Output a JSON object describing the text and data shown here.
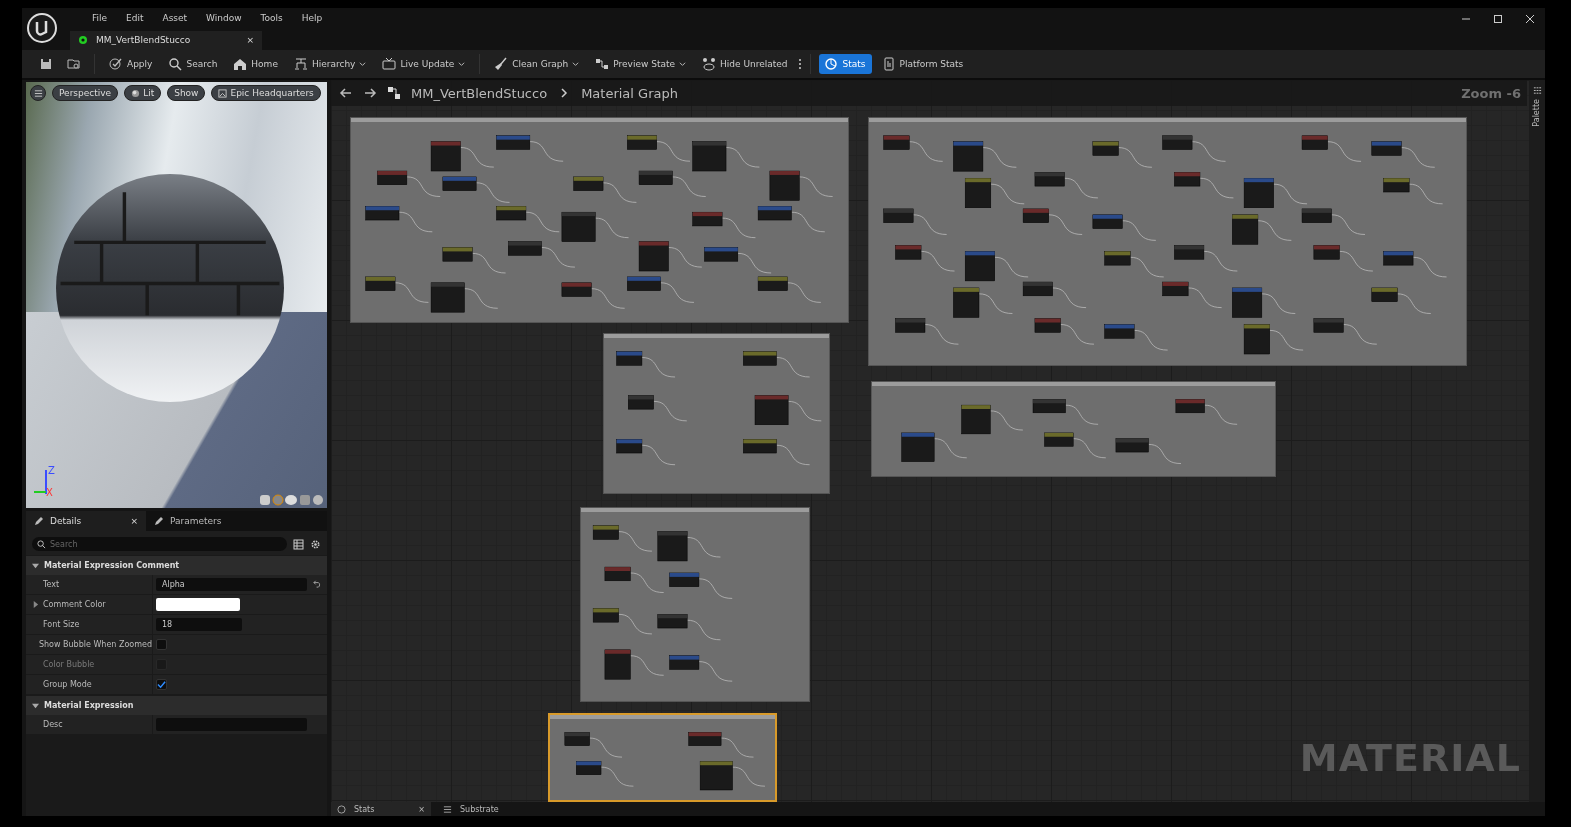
{
  "menu": [
    "File",
    "Edit",
    "Asset",
    "Window",
    "Tools",
    "Help"
  ],
  "document_tab": {
    "title": "MM_VertBlendStucco",
    "close": "×"
  },
  "toolbar": [
    {
      "kind": "icon",
      "on": false
    },
    {
      "kind": "icon",
      "on": false
    },
    {
      "label": "Apply",
      "kind": "button",
      "on": false
    },
    {
      "label": "Search",
      "kind": "button",
      "on": false
    },
    {
      "label": "Home",
      "kind": "button",
      "on": false
    },
    {
      "label": "Hierarchy",
      "kind": "dropdown",
      "on": false
    },
    {
      "label": "Live Update",
      "kind": "dropdown",
      "on": false
    },
    {
      "label": "Clean Graph",
      "kind": "dropdown",
      "on": false
    },
    {
      "label": "Preview State",
      "kind": "dropdown",
      "on": false
    },
    {
      "label": "Hide Unrelated",
      "kind": "button",
      "on": false
    },
    {
      "label": "Stats",
      "kind": "button",
      "on": true
    },
    {
      "label": "Platform Stats",
      "kind": "button",
      "on": false
    }
  ],
  "viewport": {
    "buttons": [
      "Perspective",
      "Lit",
      "Show",
      "Epic Headquarters"
    ],
    "axis_z": "Z",
    "axis_x": "X"
  },
  "details": {
    "tabs": [
      {
        "label": "Details",
        "selected": true,
        "close": "×"
      },
      {
        "label": "Parameters",
        "selected": false
      }
    ],
    "search": {
      "placeholder": "Search"
    },
    "sections": [
      {
        "title": "Material Expression Comment",
        "expanded": true,
        "rows": [
          {
            "label": "Text",
            "kind": "text",
            "value": "Alpha",
            "resettable": true
          },
          {
            "label": "Comment Color",
            "kind": "color",
            "color": "#ffffff",
            "expanded": false
          },
          {
            "label": "Font Size",
            "kind": "number",
            "value": "18"
          },
          {
            "label": "Show Bubble When Zoomed",
            "kind": "checkbox",
            "checked": false,
            "disabled": false
          },
          {
            "label": "Color Bubble",
            "kind": "checkbox",
            "checked": false,
            "disabled": true
          },
          {
            "label": "Group Mode",
            "kind": "checkbox",
            "checked": true,
            "disabled": false
          }
        ]
      },
      {
        "title": "Material Expression",
        "expanded": true,
        "rows": [
          {
            "label": "Desc",
            "kind": "text",
            "value": "",
            "resettable": false
          }
        ]
      }
    ]
  },
  "graph": {
    "breadcrumb": [
      "MM_VertBlendStucco",
      "Material Graph"
    ],
    "zoom": "Zoom -6",
    "watermark": "MATERIAL",
    "palette": "Palette",
    "comments": [
      {
        "selected": false
      },
      {
        "selected": false
      },
      {
        "selected": false
      },
      {
        "selected": false
      },
      {
        "selected": false
      },
      {
        "selected": true
      }
    ]
  },
  "bottom_tabs": [
    {
      "label": "Stats",
      "close": "×"
    },
    {
      "label": "Substrate"
    }
  ]
}
